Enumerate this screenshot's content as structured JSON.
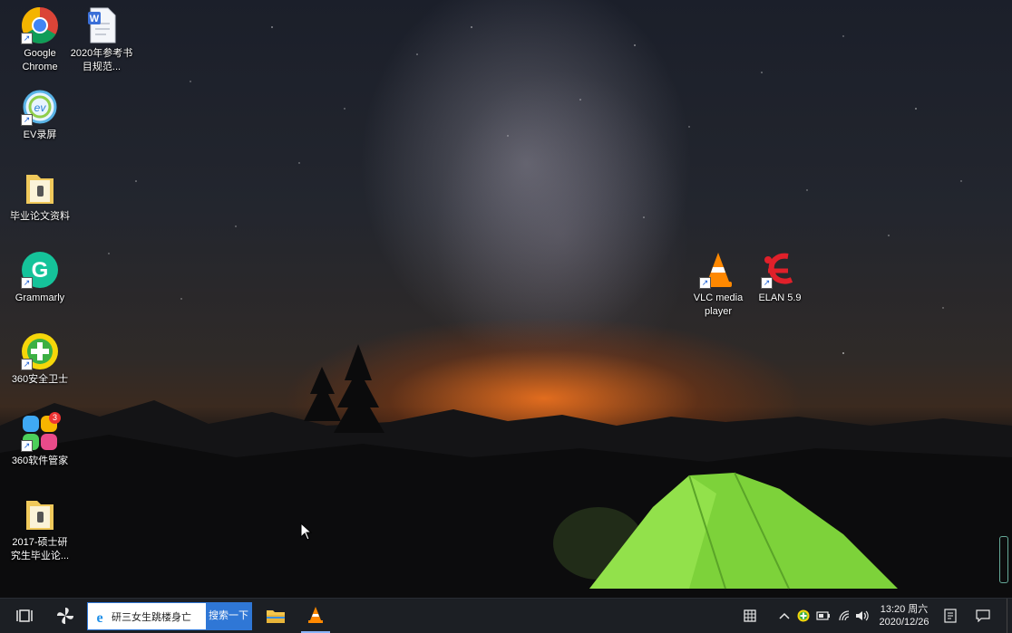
{
  "desktop_icons": [
    {
      "label": "Google Chrome",
      "icon": "chrome-icon"
    },
    {
      "label": "2020年参考书目规范...",
      "icon": "word-document-icon"
    },
    {
      "label": "EV录屏",
      "icon": "ev-recorder-icon"
    },
    {
      "label": "毕业论文资料",
      "icon": "folder-icon"
    },
    {
      "label": "Grammarly",
      "icon": "grammarly-icon"
    },
    {
      "label": "360安全卫士",
      "icon": "360-security-icon"
    },
    {
      "label": "360软件管家",
      "icon": "360-software-manager-icon"
    },
    {
      "label": "2017-硕士研究生毕业论...",
      "icon": "folder-icon"
    },
    {
      "label": "VLC media player",
      "icon": "vlc-icon"
    },
    {
      "label": "ELAN 5.9",
      "icon": "elan-icon"
    }
  ],
  "badge_360_software": "3",
  "taskbar": {
    "search_text": "研三女生跳楼身亡",
    "search_button": "搜索一下",
    "time": "13:20 周六",
    "date": "2020/12/26",
    "pinned": [
      "task-view-icon",
      "pinwheel-icon",
      "ie-icon",
      "file-explorer-icon",
      "vlc-icon"
    ],
    "tray": [
      "apps-grid-icon",
      "chevron-up-icon",
      "360-tray-icon",
      "battery-icon",
      "wifi-icon",
      "volume-icon",
      "notes-icon",
      "notifications-icon"
    ]
  },
  "colors": {
    "tent": "#7dd23a",
    "sky_glow": "#ff7a1e",
    "taskbar": "#1c1f24",
    "search_button": "#2f77d6"
  }
}
